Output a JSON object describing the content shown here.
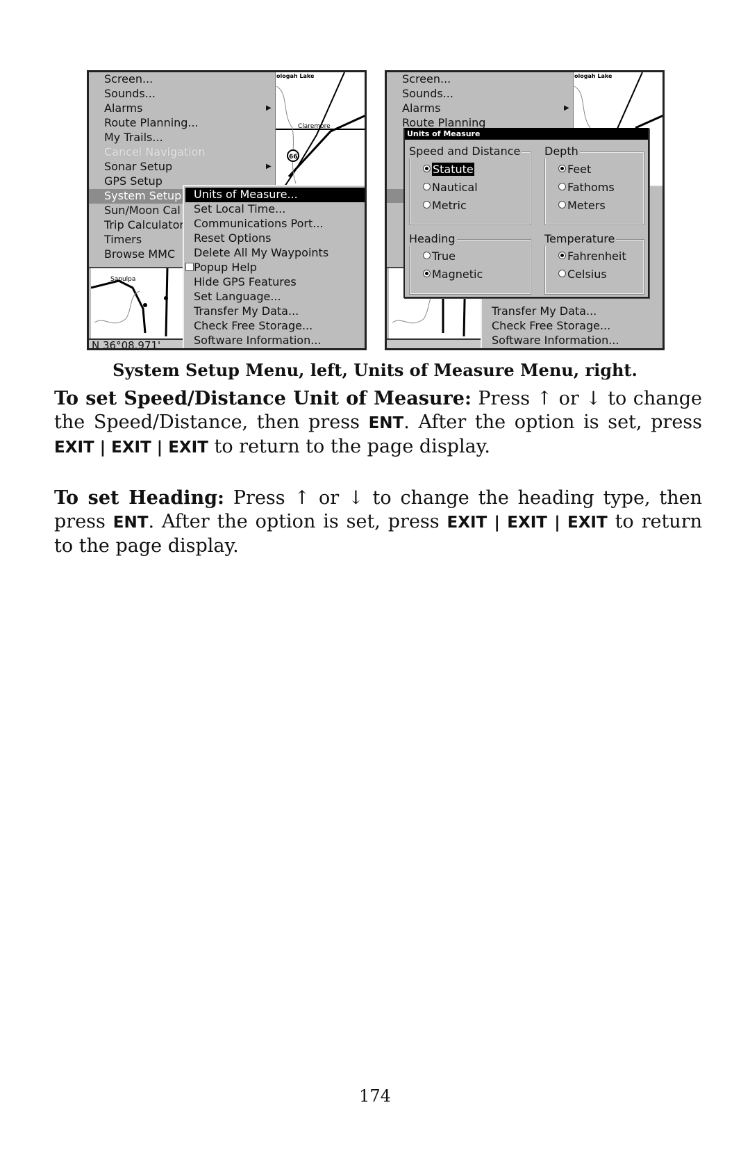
{
  "left_screen": {
    "menu": [
      "Screen...",
      "Sounds...",
      "Alarms",
      "Route Planning...",
      "My Trails...",
      "Cancel Navigation",
      "Sonar Setup",
      "GPS Setup",
      "System Setup",
      "Sun/Moon Cal",
      "Trip Calculator",
      "Timers",
      "Browse MMC"
    ],
    "submenu": [
      "Units of Measure...",
      "Set Local Time...",
      "Communications Port...",
      "Reset Options",
      "Delete All My Waypoints",
      "Popup Help",
      "Hide GPS Features",
      "Set Language...",
      "Transfer My Data...",
      "Check Free Storage...",
      "Software Information..."
    ],
    "map_labels": {
      "lake": "ologah Lake",
      "town1": "Claremore",
      "route": "66",
      "town2": "Sapulpa"
    },
    "status": "N   36°08.971'"
  },
  "right_screen": {
    "menu": [
      "Screen...",
      "Sounds...",
      "Alarms",
      "Route Planning"
    ],
    "submenu_visible": [
      "Transfer My Data...",
      "Check Free Storage...",
      "Software Information..."
    ],
    "map_labels": {
      "lake": "ologah Lake"
    },
    "dialog": {
      "title": "Units of Measure",
      "speed": {
        "label": "Speed and Distance",
        "options": [
          "Statute",
          "Nautical",
          "Metric"
        ],
        "selected": "Statute"
      },
      "depth": {
        "label": "Depth",
        "options": [
          "Feet",
          "Fathoms",
          "Meters"
        ],
        "selected": "Feet"
      },
      "heading": {
        "label": "Heading",
        "options": [
          "True",
          "Magnetic"
        ],
        "selected": "Magnetic"
      },
      "temperature": {
        "label": "Temperature",
        "options": [
          "Fahrenheit",
          "Celsius"
        ],
        "selected": "Fahrenheit"
      }
    }
  },
  "caption": "System Setup Menu, left, Units of Measure Menu, right.",
  "para1": {
    "lead": "To set Speed/Distance Unit of Measure:",
    "t1": " Press ↑ or ↓ to change the Speed/Distance, then press ",
    "k1": "ENT",
    "t2": ". After the option is set, press ",
    "k2": "EXIT | EXIT | EXIT",
    "t3": " to return to the page display."
  },
  "para2": {
    "lead": "To set Heading:",
    "t1": " Press ↑ or ↓ to change the heading type, then press ",
    "k1": "ENT",
    "t2": ". After the option is set, press ",
    "k2": "EXIT | EXIT | EXIT",
    "t3": " to return to the page display."
  },
  "page_number": "174"
}
